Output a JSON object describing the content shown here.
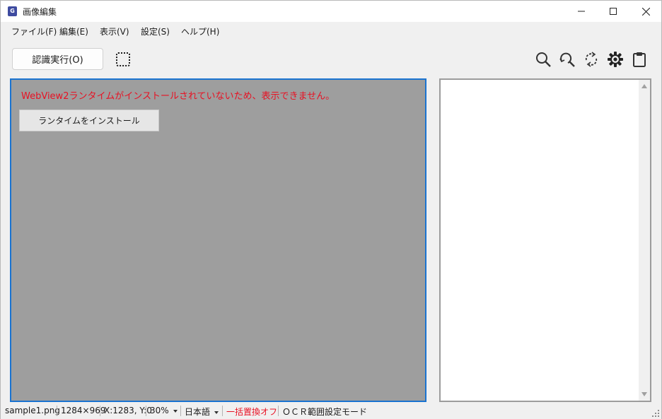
{
  "window": {
    "title": "画像編集",
    "app_icon_letter": "G"
  },
  "menu": {
    "file": "ファイル(F)",
    "edit": "編集(E)",
    "view": "表示(V)",
    "settings": "設定(S)",
    "help": "ヘルプ(H)"
  },
  "toolbar": {
    "ocr_run_label": "認識実行(O)",
    "icons": [
      "select-region-icon",
      "search-icon",
      "search-replace-icon",
      "refresh-icon",
      "gear-icon",
      "clipboard-icon"
    ]
  },
  "webview": {
    "error_message": "WebView2ランタイムがインストールされていないため、表示できません。",
    "install_button_label": "ランタイムをインストール"
  },
  "statusbar": {
    "filename": "sample1.png",
    "dimensions": "1284×969",
    "coords": "X:1283, Y:0",
    "zoom": "30%",
    "language": "日本語",
    "replace_mode": "一括置換オフ",
    "mode": "ＯＣＲ範囲設定モード"
  },
  "colors": {
    "accent_border": "#1a73d0",
    "error_text": "#e81123",
    "webview_bg": "#9e9e9e"
  }
}
